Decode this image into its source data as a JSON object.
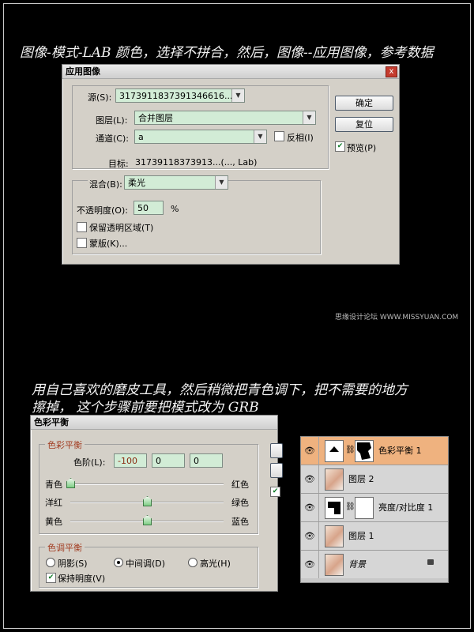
{
  "notes": {
    "top": "图像-模式-LAB 颜色，选择不拼合，然后，图像--应用图像，参考数据",
    "middle_line1": "用自己喜欢的磨皮工具，然后稍微把青色调下，把不需要的地方",
    "middle_line2": "擦掉， 这个步骤前要把模式改为 GRB"
  },
  "watermark": "思缘设计论坛 WWW.MISSYUAN.COM",
  "apply_image": {
    "title": "应用图像",
    "close": "x",
    "source_label": "源(S):",
    "source_value": "3173911837391346616...",
    "layer_label": "图层(L):",
    "layer_value": "合并图层",
    "channel_label": "通道(C):",
    "channel_value": "a",
    "invert_label": "反相(I)",
    "target_label": "目标:",
    "target_value": "31739118373913...(..., Lab)",
    "blend_label": "混合(B):",
    "blend_value": "柔光",
    "opacity_label": "不透明度(O):",
    "opacity_value": "50",
    "opacity_unit": "%",
    "preserve_label": "保留透明区域(T)",
    "mask_label": "蒙版(K)...",
    "ok_label": "确定",
    "reset_label": "复位",
    "preview_label": "预览(P)",
    "preview_checked": true
  },
  "color_balance": {
    "title": "色彩平衡",
    "group1_title": "色彩平衡",
    "levels_label": "色阶(L):",
    "level1": "-100",
    "level2": "0",
    "level3": "0",
    "cyan": "青色",
    "red": "红色",
    "magenta": "洋红",
    "green": "绿色",
    "yellow": "黄色",
    "blue": "蓝色",
    "slider_values": [
      -100,
      0,
      0
    ],
    "group2_title": "色调平衡",
    "shadows": "阴影(S)",
    "midtones": "中间调(D)",
    "highlights": "高光(H)",
    "selected_tone": "midtones",
    "preserve_luminosity": "保持明度(V)",
    "preserve_checked": true
  },
  "layers": [
    {
      "name": "色彩平衡 1",
      "active": true
    },
    {
      "name": "图层 2",
      "active": false
    },
    {
      "name": "亮度/对比度 1",
      "active": false
    },
    {
      "name": "图层 1",
      "active": false
    },
    {
      "name": "背景",
      "active": false,
      "locked": true
    }
  ],
  "colors": {
    "field_green": "#d2ecd6",
    "active_layer": "#efb27f",
    "group_title": "#a23d22"
  }
}
